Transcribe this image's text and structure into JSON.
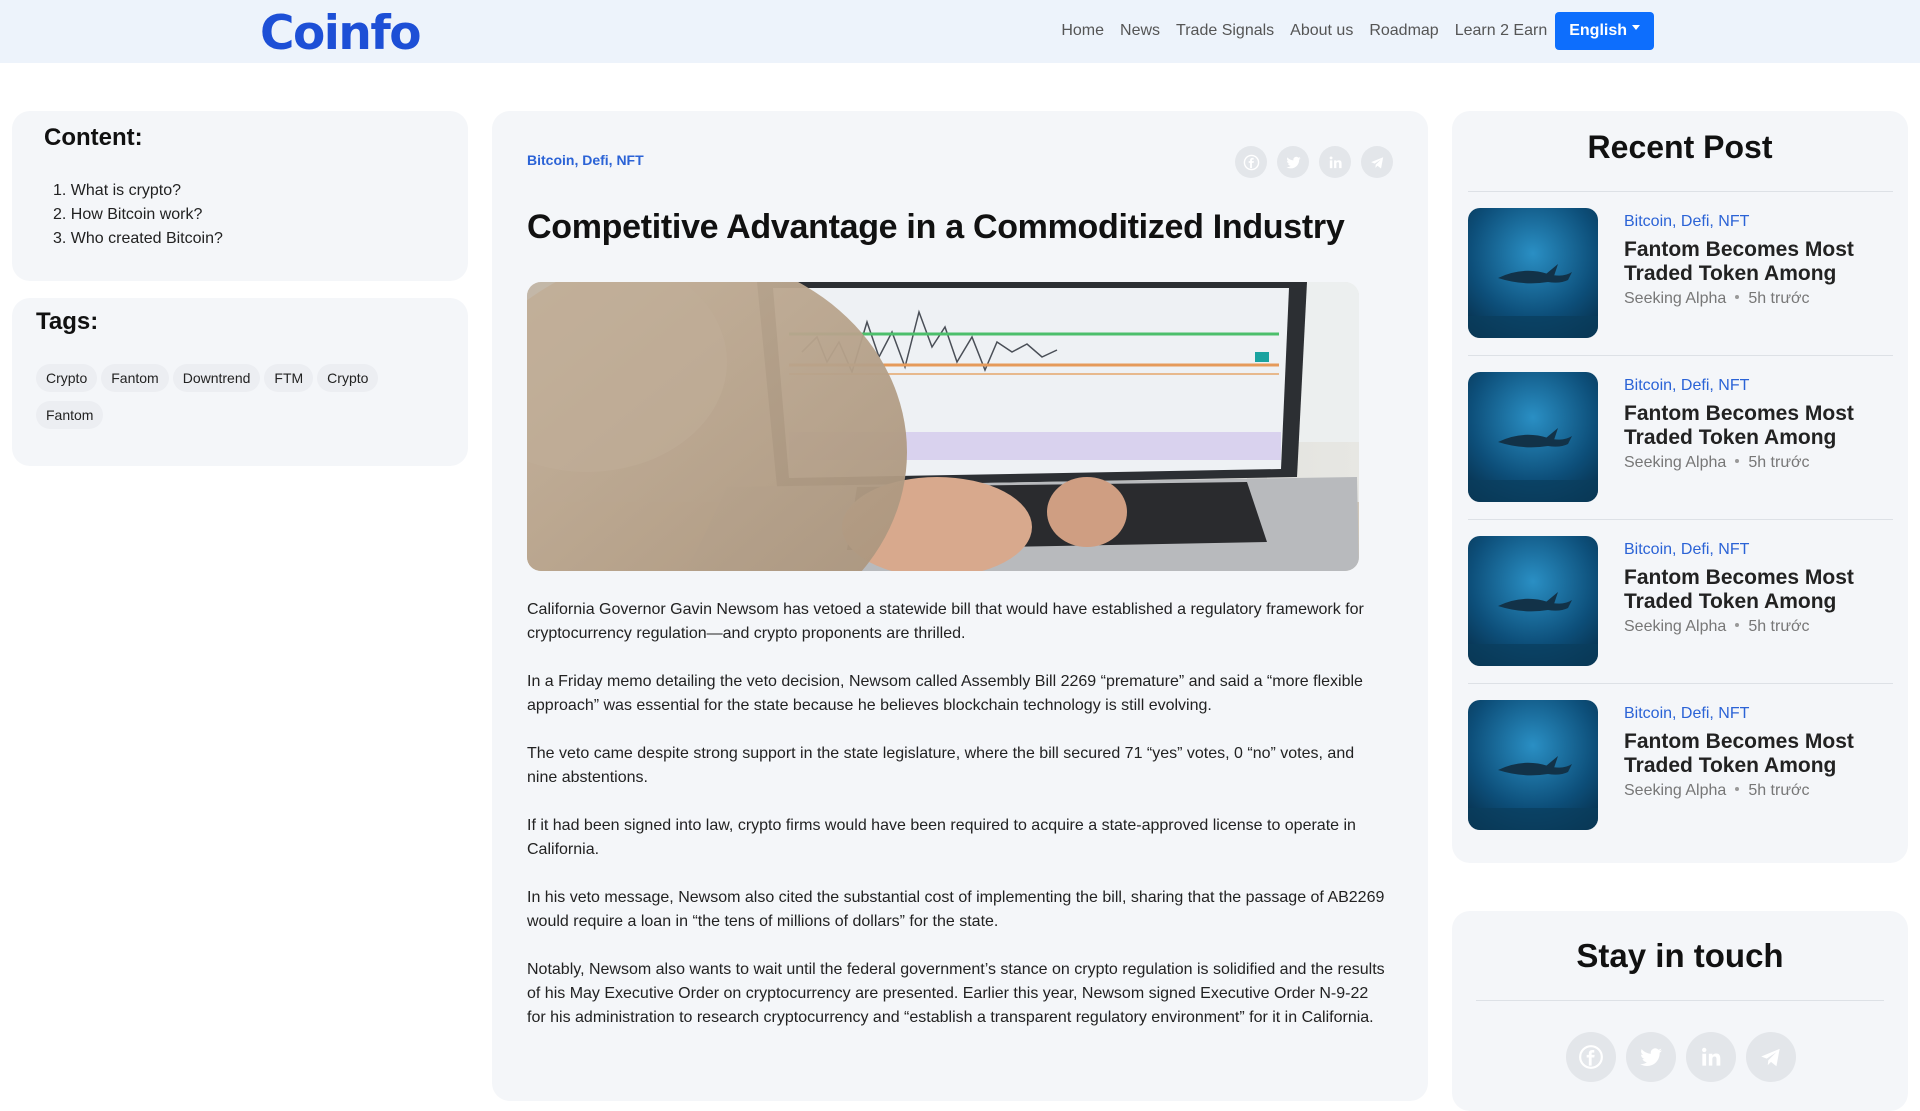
{
  "header": {
    "logo": "Coinfo",
    "nav": [
      "Home",
      "News",
      "Trade Signals",
      "About us",
      "Roadmap",
      "Learn 2 Earn"
    ],
    "language": "English"
  },
  "toc": {
    "heading": "Content:",
    "items": [
      "1. What is crypto?",
      "2. How Bitcoin work?",
      "3. Who created Bitcoin?"
    ]
  },
  "tags": {
    "heading": "Tags:",
    "items": [
      "Crypto",
      "Fantom",
      "Downtrend",
      "FTM",
      "Crypto",
      "Fantom"
    ]
  },
  "article": {
    "categories": "Bitcoin, Defi, NFT",
    "share_icons": [
      "facebook-icon",
      "twitter-icon",
      "linkedin-icon",
      "telegram-icon"
    ],
    "title": "Competitive Advantage in a Commoditized Industry",
    "paragraphs": [
      "California Governor Gavin Newsom has vetoed a statewide bill that would have established a regulatory framework for cryptocurrency regulation—and crypto proponents are thrilled.",
      "In a Friday memo detailing the veto decision, Newsom called Assembly Bill 2269 “premature” and said a “more flexible approach” was essential for the state because he believes blockchain technology is still evolving.",
      "The veto came despite strong support in the state legislature, where the bill secured 71 “yes” votes, 0 “no” votes, and nine abstentions.",
      "If it had been signed into law, crypto firms would have been required to acquire a state-approved license to operate in California.",
      "In his veto message, Newsom also cited the substantial cost of implementing the bill, sharing that the passage of AB2269 would require a loan in “the tens of millions of dollars” for the state.",
      "Notably, Newsom also wants to wait until the federal government’s stance on crypto regulation is solidified and the results of his May Executive Order on cryptocurrency are presented. Earlier this year, Newsom signed Executive Order N-9-22 for his administration to research cryptocurrency and “establish a transparent regulatory environment” for it in California."
    ]
  },
  "recent": {
    "heading": "Recent Post",
    "posts": [
      {
        "categories": "Bitcoin, Defi, NFT",
        "title": "Fantom Becomes Most Traded Token Among",
        "source": "Seeking Alpha",
        "time": "5h trước"
      },
      {
        "categories": "Bitcoin, Defi, NFT",
        "title": "Fantom Becomes Most Traded Token Among",
        "source": "Seeking Alpha",
        "time": "5h trước"
      },
      {
        "categories": "Bitcoin, Defi, NFT",
        "title": "Fantom Becomes Most Traded Token Among",
        "source": "Seeking Alpha",
        "time": "5h trước"
      },
      {
        "categories": "Bitcoin, Defi, NFT",
        "title": "Fantom Becomes Most Traded Token Among",
        "source": "Seeking Alpha",
        "time": "5h trước"
      }
    ]
  },
  "touch": {
    "heading": "Stay in touch",
    "icons": [
      "facebook-icon",
      "twitter-icon",
      "linkedin-icon",
      "telegram-icon"
    ]
  },
  "colors": {
    "brand": "#1d4fd6",
    "accent_button": "#0d6efd",
    "link": "#2b63d6",
    "card_bg": "#f4f6f9",
    "nav_bg": "#edf3fb"
  }
}
